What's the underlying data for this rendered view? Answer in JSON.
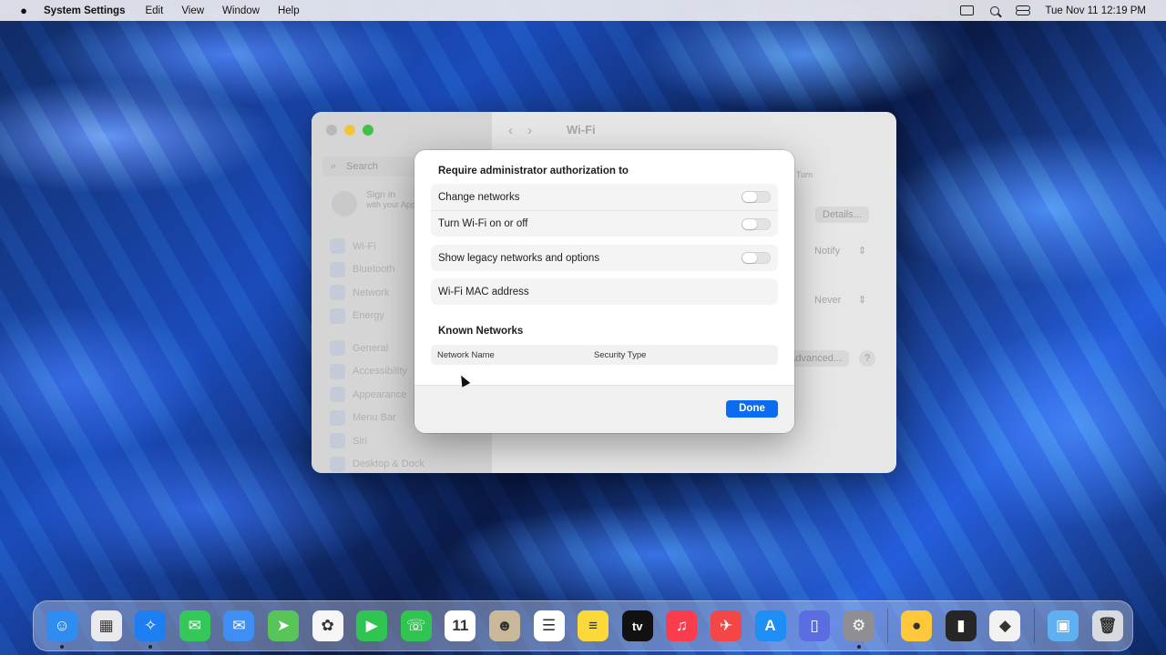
{
  "menubar": {
    "app_name": "System Settings",
    "menus": [
      "Edit",
      "View",
      "Window",
      "Help"
    ],
    "datetime": "Tue Nov 11  12:19 PM"
  },
  "settings_window": {
    "search_placeholder": "Search",
    "signin_title": "Sign in",
    "signin_sub": "with your Apple Acc...",
    "sidebar_items": [
      "Wi-Fi",
      "Bluetooth",
      "Network",
      "Energy",
      "General",
      "Accessibility",
      "Appearance",
      "Menu Bar",
      "Siri",
      "Desktop & Dock"
    ],
    "title": "Wi-Fi",
    "turn_label": "Turn",
    "details_button": "Details...",
    "notify_value": "Notify",
    "never_value": "Never",
    "advanced_button": "Advanced...",
    "help_button": "?"
  },
  "sheet": {
    "section_title": "Require administrator authorization to",
    "admin_options": [
      {
        "label": "Change networks",
        "on": false
      },
      {
        "label": "Turn Wi-Fi on or off",
        "on": false
      }
    ],
    "legacy_option": {
      "label": "Show legacy networks and options",
      "on": false
    },
    "mac_address_label": "Wi-Fi MAC address",
    "known_networks_title": "Known Networks",
    "table_columns": [
      "Network Name",
      "Security Type"
    ],
    "table_rows": [],
    "done_button": "Done"
  },
  "dock": {
    "apps": [
      {
        "name": "Finder",
        "color": "#2f8cf0",
        "glyph": "☺",
        "running": true
      },
      {
        "name": "Launchpad",
        "color": "#e9e9ee",
        "glyph": "▦",
        "running": false
      },
      {
        "name": "Safari",
        "color": "#1d7ef2",
        "glyph": "✧",
        "running": true
      },
      {
        "name": "Messages",
        "color": "#34c759",
        "glyph": "✉",
        "running": false
      },
      {
        "name": "Mail",
        "color": "#3f8ef5",
        "glyph": "✉",
        "running": false
      },
      {
        "name": "Maps",
        "color": "#58c55a",
        "glyph": "➤",
        "running": false
      },
      {
        "name": "Photos",
        "color": "#f5f5f5",
        "glyph": "✿",
        "running": false
      },
      {
        "name": "FaceTime",
        "color": "#30c451",
        "glyph": "▶",
        "running": false
      },
      {
        "name": "Phone",
        "color": "#30c451",
        "glyph": "☏",
        "running": false
      },
      {
        "name": "Calendar",
        "color": "#ffffff",
        "glyph": "11",
        "running": false
      },
      {
        "name": "Contacts",
        "color": "#c9b89a",
        "glyph": "☻",
        "running": false
      },
      {
        "name": "Reminders",
        "color": "#ffffff",
        "glyph": "☰",
        "running": false
      },
      {
        "name": "Notes",
        "color": "#fbd93a",
        "glyph": "≡",
        "running": false
      },
      {
        "name": "TV",
        "color": "#111111",
        "glyph": "tv",
        "running": false
      },
      {
        "name": "Music",
        "color": "#fa3c4c",
        "glyph": "♫",
        "running": false
      },
      {
        "name": "Instruments",
        "color": "#f44646",
        "glyph": "✈",
        "running": false
      },
      {
        "name": "App Store",
        "color": "#1c8ef5",
        "glyph": "A",
        "running": false
      },
      {
        "name": "iPhone Mirroring",
        "color": "#5b6ee1",
        "glyph": "▯",
        "running": false
      },
      {
        "name": "System Settings",
        "color": "#8e8e93",
        "glyph": "⚙",
        "running": true
      },
      {
        "name": "Tips",
        "color": "#ffc83a",
        "glyph": "●",
        "running": false
      },
      {
        "name": "Sidecar",
        "color": "#262626",
        "glyph": "▮",
        "running": false
      },
      {
        "name": "Automator",
        "color": "#f2f2f2",
        "glyph": "◆",
        "running": false
      },
      {
        "name": "Downloads",
        "color": "#5fb0f0",
        "glyph": "▣",
        "running": false
      },
      {
        "name": "Trash",
        "color": "#d7dbe0",
        "glyph": "🗑",
        "running": false
      }
    ]
  }
}
